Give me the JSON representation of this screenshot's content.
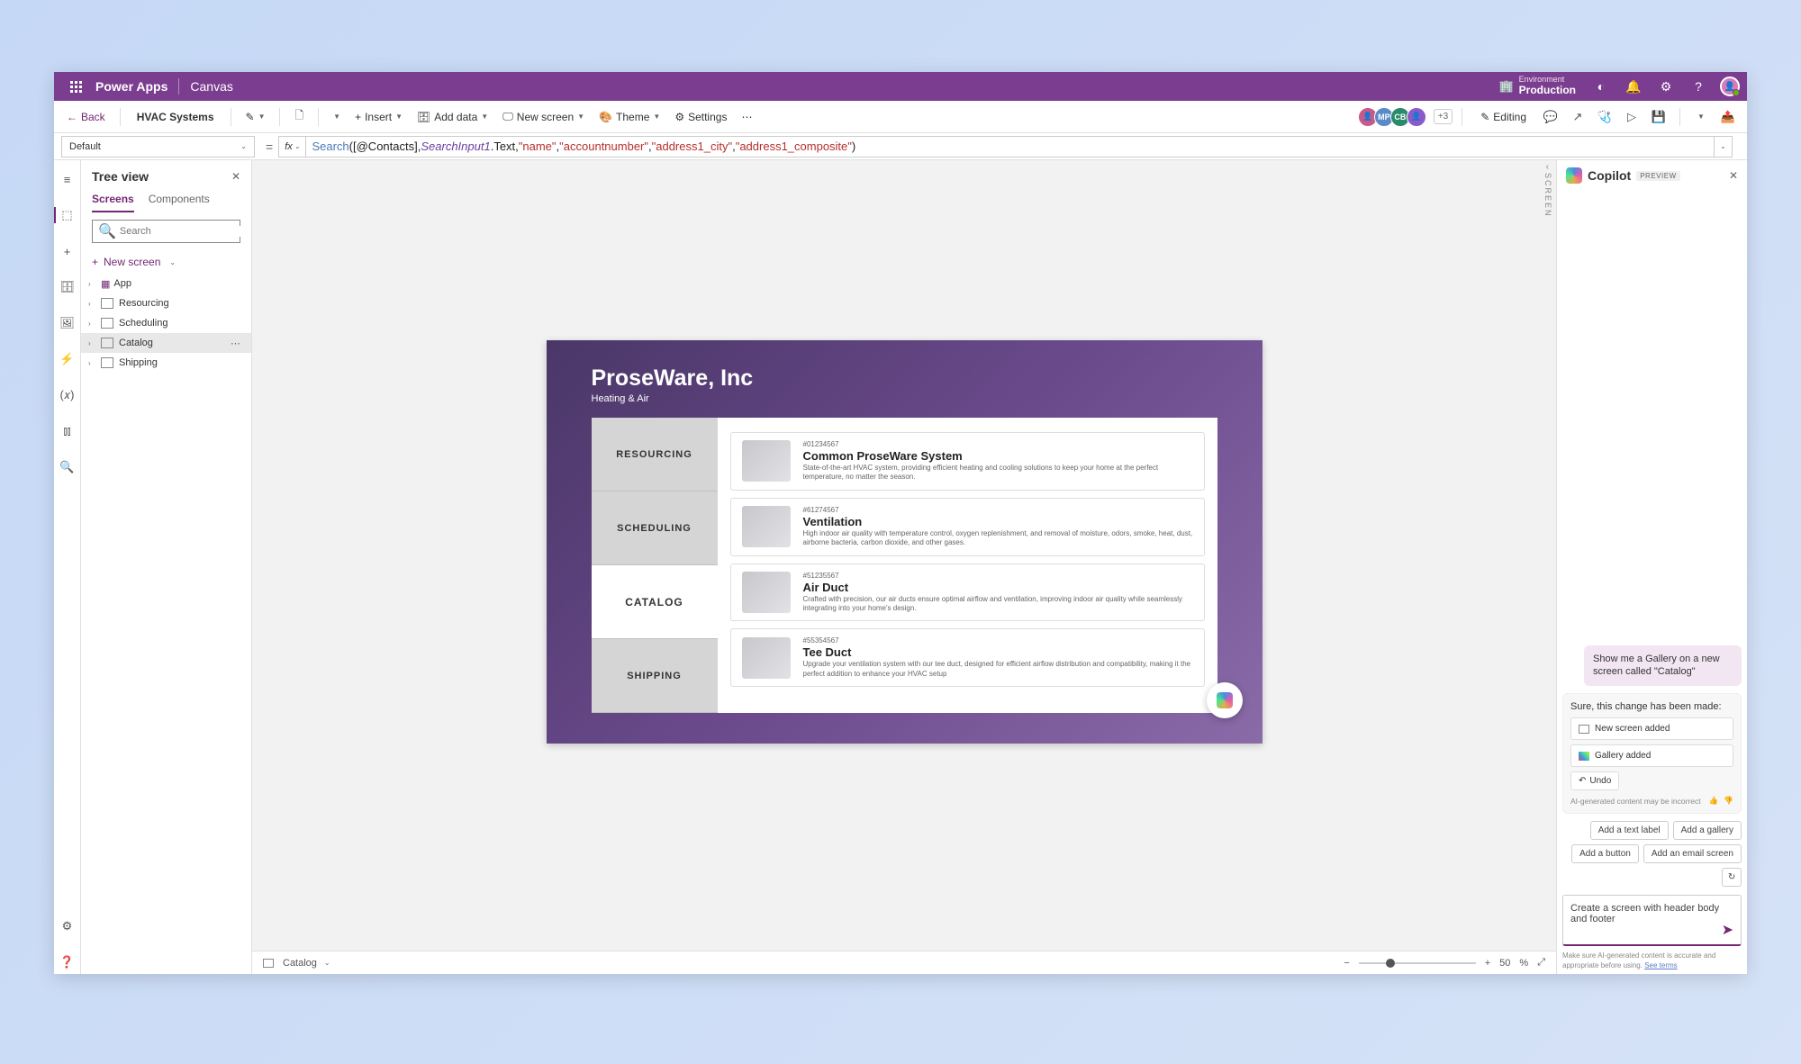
{
  "header": {
    "app_name": "Power Apps",
    "mode": "Canvas",
    "environment_label": "Environment",
    "environment_value": "Production"
  },
  "ribbon": {
    "back": "Back",
    "app_title": "HVAC Systems",
    "insert": "Insert",
    "add_data": "Add data",
    "new_screen": "New screen",
    "theme": "Theme",
    "settings": "Settings",
    "collab_more": "+3",
    "editing": "Editing"
  },
  "formula": {
    "property": "Default",
    "tokens": {
      "func": "Search",
      "open": "(",
      "contacts": "[@Contacts]",
      "comma1": ", ",
      "searchinput": "SearchInput1",
      "dottext": ".Text, ",
      "s_name": "\"name\"",
      "c2": ", ",
      "s_acct": "\"accountnumber\"",
      "c3": ", ",
      "s_city": "\"address1_city\"",
      "c4": ", ",
      "s_comp": "\"address1_composite\"",
      "close": ")"
    }
  },
  "tree": {
    "title": "Tree view",
    "tab_screens": "Screens",
    "tab_components": "Components",
    "search_placeholder": "Search",
    "new_screen": "New screen",
    "items": [
      {
        "label": "App"
      },
      {
        "label": "Resourcing"
      },
      {
        "label": "Scheduling"
      },
      {
        "label": "Catalog"
      },
      {
        "label": "Shipping"
      }
    ]
  },
  "canvas_side_label": "SCREEN",
  "mock": {
    "company": "ProseWare, Inc",
    "subtitle": "Heating & Air",
    "nav": [
      "RESOURCING",
      "SCHEDULING",
      "CATALOG",
      "SHIPPING"
    ],
    "products": [
      {
        "sku": "#01234567",
        "title": "Common ProseWare System",
        "desc": "State-of-the-art HVAC system, providing efficient heating and cooling solutions to keep your home at the perfect temperature, no matter the season."
      },
      {
        "sku": "#61274567",
        "title": "Ventilation",
        "desc": "High indoor air quality with temperature control, oxygen replenishment, and removal of moisture, odors, smoke, heat, dust, airborne bacteria, carbon dioxide, and other gases."
      },
      {
        "sku": "#51235567",
        "title": "Air Duct",
        "desc": "Crafted with precision, our air ducts ensure optimal airflow and ventilation, improving indoor air quality while seamlessly integrating into your home's design."
      },
      {
        "sku": "#55354567",
        "title": "Tee Duct",
        "desc": "Upgrade your ventilation system with our tee duct, designed for efficient airflow distribution and compatibility, making it the perfect addition to enhance your HVAC setup"
      }
    ]
  },
  "canvas_footer": {
    "selected": "Catalog",
    "zoom_value": "50",
    "zoom_unit": "%"
  },
  "copilot": {
    "title": "Copilot",
    "badge": "PREVIEW",
    "user_msg": "Show me a Gallery on a new screen called \"Catalog\"",
    "ai_msg": "Sure, this change has been made:",
    "change1": "New screen added",
    "change2": "Gallery added",
    "undo": "Undo",
    "disclaimer_small": "AI-generated content may be incorrect",
    "suggestions": [
      "Add a text label",
      "Add a gallery",
      "Add a button",
      "Add an email screen"
    ],
    "input_value": "Create a screen with header body and footer",
    "footer_disclaimer": "Make sure AI-generated content is accurate and appropriate before using.",
    "see_terms": "See terms"
  }
}
